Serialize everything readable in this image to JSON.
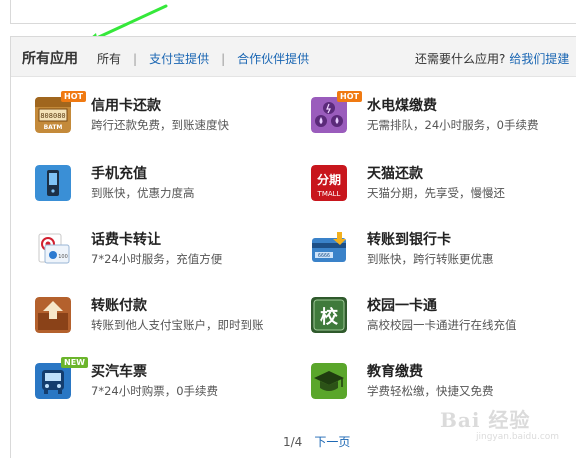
{
  "header": {
    "title": "所有应用",
    "filter_all": "所有",
    "filter_alipay": "支付宝提供",
    "filter_partner": "合作伙伴提供",
    "need_more": "还需要什么应用?",
    "tell_us": "给我们提建"
  },
  "apps": [
    {
      "name": "信用卡还款",
      "desc": "跨行还款免费，到账速度快",
      "icon": "atm-card-icon",
      "badge": "HOT",
      "color": "#b8782a"
    },
    {
      "name": "水电煤缴费",
      "desc": "无需排队，24小时服务，0手续费",
      "icon": "utility-bill-icon",
      "badge": "HOT",
      "color": "#8a4ea8"
    },
    {
      "name": "手机充值",
      "desc": "到账快，优惠力度高",
      "icon": "mobile-phone-icon",
      "badge": "",
      "color": "#2f86d1"
    },
    {
      "name": "天猫还款",
      "desc": "天猫分期，先享受，慢慢还",
      "icon": "tmall-installment-icon",
      "badge": "",
      "color": "#c8161d"
    },
    {
      "name": "话费卡转让",
      "desc": "7*24小时服务，充值方便",
      "icon": "phone-card-icon",
      "badge": "",
      "color": "#d22030"
    },
    {
      "name": "转账到银行卡",
      "desc": "到账快，跨行转账更优惠",
      "icon": "bank-card-icon",
      "badge": "",
      "color": "#3a82c9"
    },
    {
      "name": "转账付款",
      "desc": "转账到他人支付宝账户，即时到账",
      "icon": "transfer-box-icon",
      "badge": "",
      "color": "#a9562a"
    },
    {
      "name": "校园一卡通",
      "desc": "高校校园一卡通进行在线充值",
      "icon": "campus-card-icon",
      "badge": "",
      "color": "#3d6b3a"
    },
    {
      "name": "买汽车票",
      "desc": "7*24小时购票，0手续费",
      "icon": "bus-ticket-icon",
      "badge": "NEW",
      "color": "#2a77c4"
    },
    {
      "name": "教育缴费",
      "desc": "学费轻松缴，快捷又免费",
      "icon": "graduation-cap-icon",
      "badge": "",
      "color": "#5aa62b"
    }
  ],
  "icon_text": {
    "atm_screen": "808080",
    "atm_label": "BATM",
    "tmall_top": "分期",
    "tmall_bottom": "TMALL",
    "phonecard_text": "100",
    "bankcard_text": "6666",
    "campus_char": "校"
  },
  "pager": {
    "current": "1/4",
    "next": "下一页"
  },
  "watermark": {
    "text": "Bai 经验",
    "url": "jingyan.baidu.com"
  }
}
